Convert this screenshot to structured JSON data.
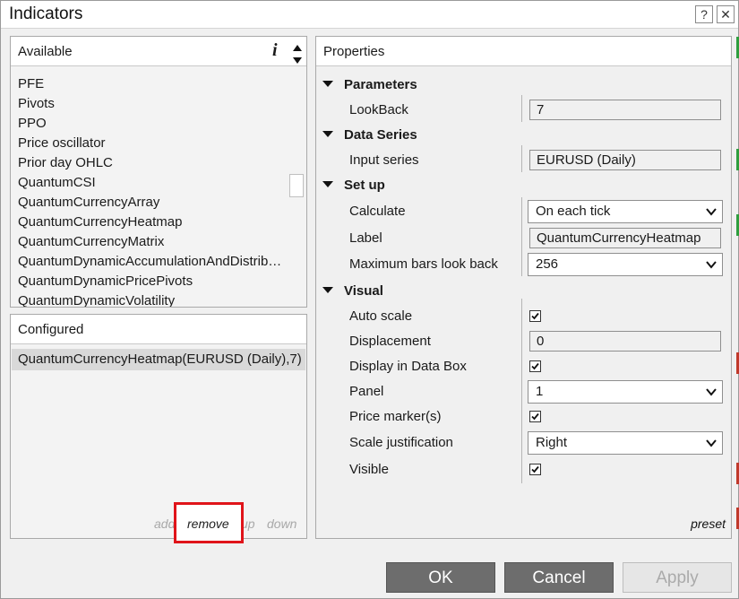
{
  "window": {
    "title": "Indicators",
    "help_label": "?",
    "close_label": "✕"
  },
  "available": {
    "header": "Available",
    "info_label": "i",
    "items": [
      "PFE",
      "Pivots",
      "PPO",
      "Price oscillator",
      "Prior day OHLC",
      "QuantumCSI",
      "QuantumCurrencyArray",
      "QuantumCurrencyHeatmap",
      "QuantumCurrencyMatrix",
      "QuantumDynamicAccumulationAndDistrib…",
      "QuantumDynamicPricePivots",
      "QuantumDynamicVolatility"
    ]
  },
  "configured": {
    "header": "Configured",
    "items": [
      "QuantumCurrencyHeatmap(EURUSD (Daily),7)"
    ],
    "actions": {
      "add": "add",
      "remove": "remove",
      "up": "up",
      "down": "down"
    }
  },
  "properties": {
    "header": "Properties",
    "sections": {
      "parameters": {
        "title": "Parameters",
        "lookback_label": "LookBack",
        "lookback_value": "7"
      },
      "data_series": {
        "title": "Data Series",
        "input_label": "Input series",
        "input_value": "EURUSD (Daily)"
      },
      "setup": {
        "title": "Set up",
        "calculate_label": "Calculate",
        "calculate_value": "On each tick",
        "label_label": "Label",
        "label_value": "QuantumCurrencyHeatmap",
        "maxbars_label": "Maximum bars look back",
        "maxbars_value": "256"
      },
      "visual": {
        "title": "Visual",
        "autoscale_label": "Auto scale",
        "autoscale_checked": true,
        "displacement_label": "Displacement",
        "displacement_value": "0",
        "databox_label": "Display in Data Box",
        "databox_checked": true,
        "panel_label": "Panel",
        "panel_value": "1",
        "pricemarker_label": "Price marker(s)",
        "pricemarker_checked": true,
        "scalejust_label": "Scale justification",
        "scalejust_value": "Right",
        "visible_label": "Visible",
        "visible_checked": true
      }
    },
    "preset_label": "preset"
  },
  "buttons": {
    "ok": "OK",
    "cancel": "Cancel",
    "apply": "Apply"
  },
  "colors": {
    "highlight": "#e0141a",
    "button_dark": "#6d6d6d",
    "selected_row": "#d9d9d9"
  }
}
